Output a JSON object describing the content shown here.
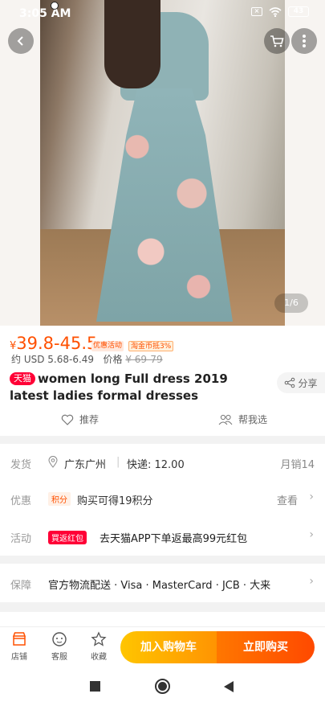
{
  "status_bar": {
    "time": "3:05 AM",
    "battery": "43"
  },
  "gallery": {
    "pager": "1/6"
  },
  "product": {
    "price_symbol": "¥",
    "price_range": "39.8-45.5",
    "promo_tag": "优惠活动",
    "coin_tag": "淘金币抵3%",
    "usd_text": "约 USD 5.68-6.49",
    "orig_label": "价格",
    "orig_price": "¥ 69-79",
    "tmall_badge": "天猫",
    "title": "women long Full dress 2019 latest ladies formal dresses",
    "share_label": "分享",
    "recommend_label": "推荐",
    "help_select_label": "帮我选"
  },
  "shipping": {
    "label": "发货",
    "location": "广东广州",
    "express": "快递: 12.00",
    "monthly_sales": "月销14"
  },
  "discount": {
    "label": "优惠",
    "badge": "积分",
    "text": "购买可得19积分",
    "action": "查看"
  },
  "activity": {
    "label": "活动",
    "badge": "買返红包",
    "text": "去天猫APP下单返最高99元红包"
  },
  "guarantee": {
    "label": "保障",
    "text": "官方物流配送 · Visa · MasterCard · JCB · 大来"
  },
  "bottom_bar": {
    "store": "店铺",
    "service": "客服",
    "favorite": "收藏",
    "add_to_cart": "加入购物车",
    "buy_now": "立即购买"
  },
  "colors": {
    "accent": "#ff5000",
    "tmall_red": "#ff0036"
  }
}
